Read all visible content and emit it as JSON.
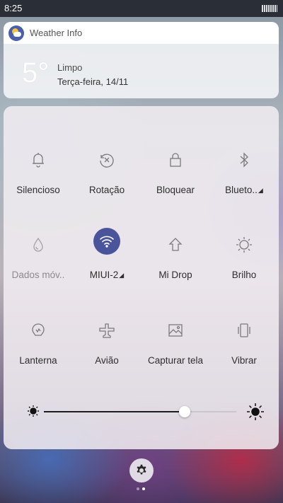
{
  "status_bar": {
    "time": "8:25"
  },
  "weather": {
    "app_name": "Weather Info",
    "temperature": "5°",
    "condition": "Limpo",
    "date": "Terça-feira, 14/11"
  },
  "toggles": {
    "row1": [
      {
        "label": "Silencioso",
        "icon": "bell-icon"
      },
      {
        "label": "Rotação",
        "icon": "rotation-lock-icon"
      },
      {
        "label": "Bloquear",
        "icon": "lock-icon"
      },
      {
        "label": "Blueto..",
        "icon": "bluetooth-icon",
        "has_menu": true
      }
    ],
    "row2": [
      {
        "label": "Dados móv..",
        "icon": "mobile-data-icon",
        "disabled": true
      },
      {
        "label": "MIUI-2",
        "icon": "wifi-icon",
        "active": true,
        "has_menu": true
      },
      {
        "label": "Mi Drop",
        "icon": "mi-drop-icon"
      },
      {
        "label": "Brilho",
        "icon": "brightness-icon"
      }
    ],
    "row3": [
      {
        "label": "Lanterna",
        "icon": "flashlight-icon"
      },
      {
        "label": "Avião",
        "icon": "airplane-icon"
      },
      {
        "label": "Capturar tela",
        "icon": "screenshot-icon"
      },
      {
        "label": "Vibrar",
        "icon": "vibrate-icon"
      }
    ]
  },
  "brightness_slider": {
    "level": 0.73
  },
  "colors": {
    "accent": "#4a549b"
  },
  "pager": {
    "pages": 2,
    "current": 2
  }
}
